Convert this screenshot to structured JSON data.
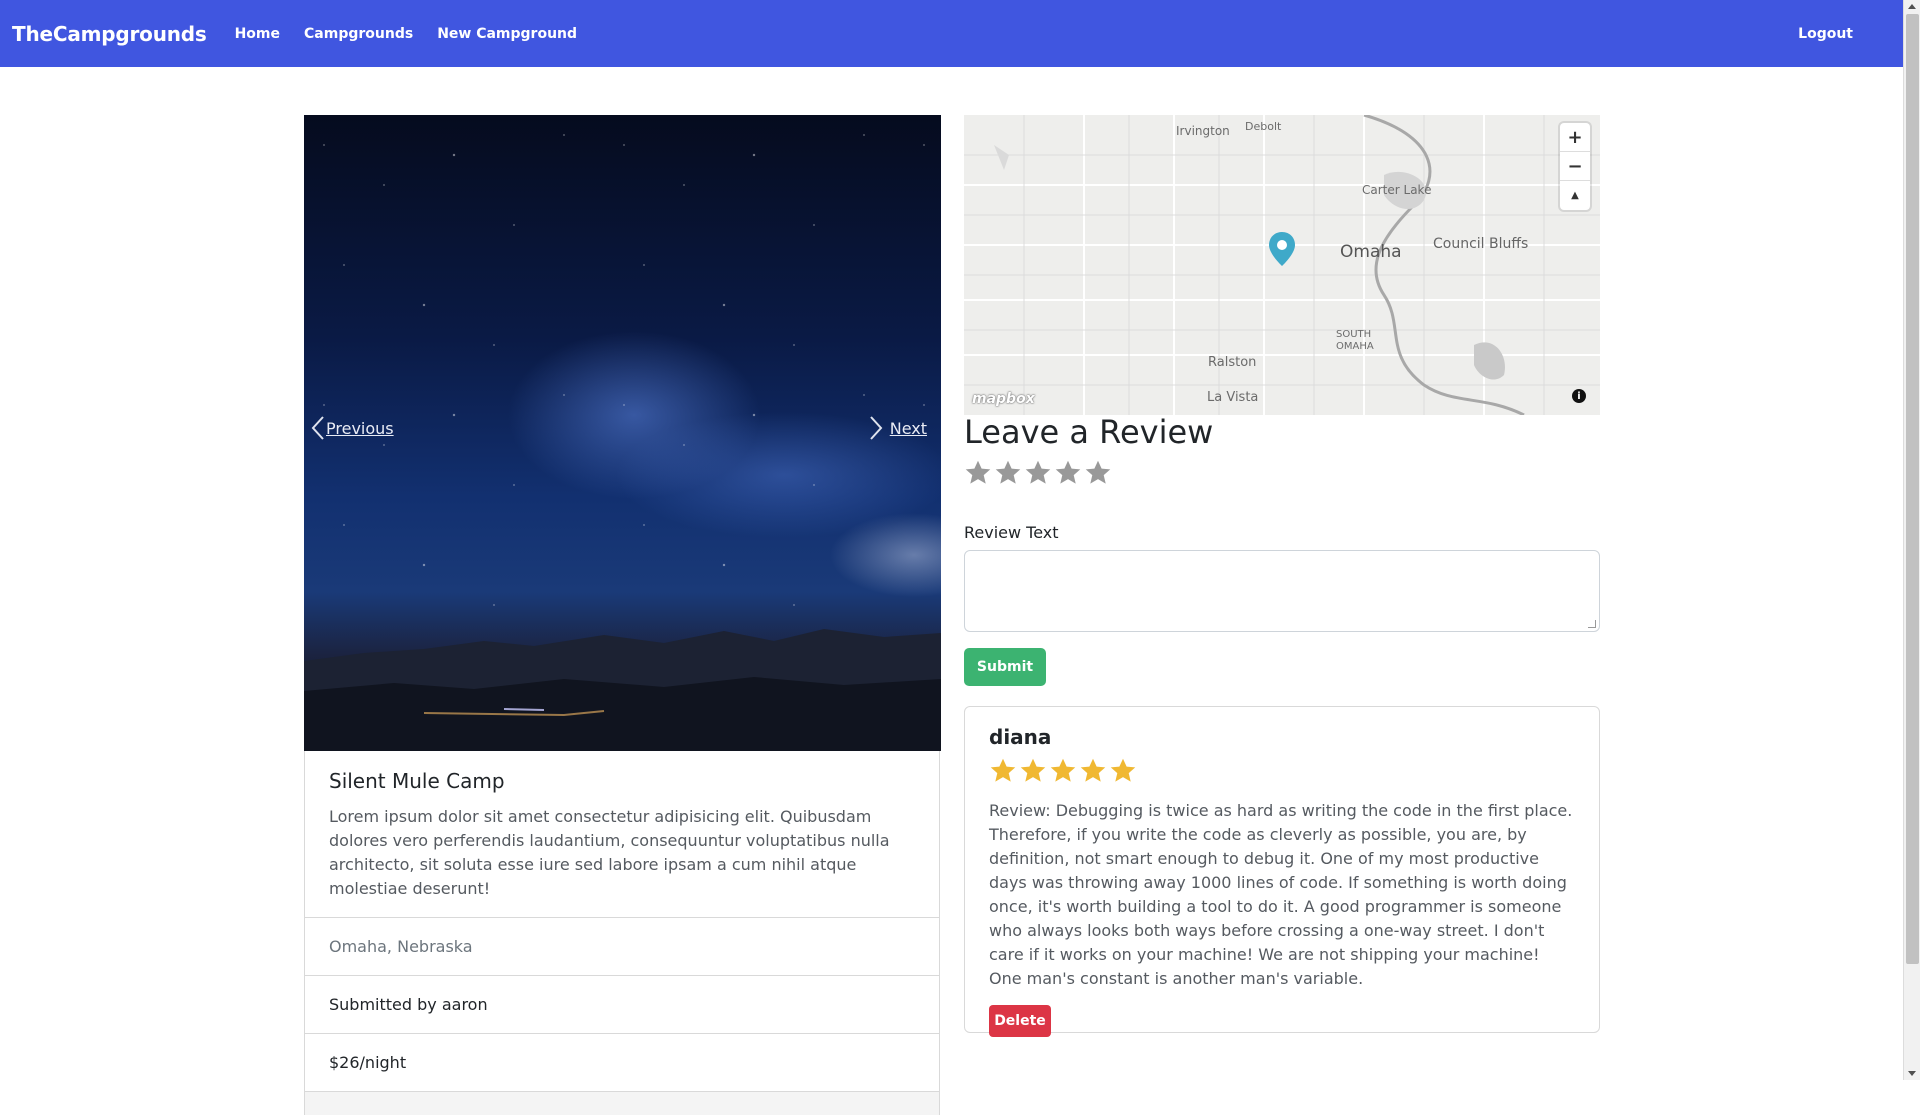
{
  "navbar": {
    "brand": "TheCampgrounds",
    "links": [
      "Home",
      "Campgrounds",
      "New Campground"
    ],
    "logout": "Logout",
    "color": "#4056e0"
  },
  "carousel": {
    "prev_label": "Previous",
    "next_label": "Next"
  },
  "campground": {
    "title": "Silent Mule Camp",
    "description": "Lorem ipsum dolor sit amet consectetur adipisicing elit. Quibusdam dolores vero perferendis laudantium, consequuntur voluptatibus nulla architecto, sit soluta esse iure sed labore ipsam a cum nihil atque molestiae deserunt!",
    "location": "Omaha, Nebraska",
    "submitted_by": "Submitted by aaron",
    "price": "$26/night"
  },
  "map": {
    "labels": {
      "irvington": "Irvington",
      "debolt": "Debolt",
      "carter_lake": "Carter Lake",
      "omaha": "Omaha",
      "council_bluffs": "Council Bluffs",
      "south_omaha": "SOUTH OMAHA",
      "ralston": "Ralston",
      "la_vista": "La Vista"
    },
    "attribution": "mapbox",
    "zoom_in": "+",
    "zoom_out": "−",
    "compass": "▲",
    "marker_color": "#3fa9c9"
  },
  "review_form": {
    "title": "Leave a Review",
    "rating": 0,
    "max_rating": 5,
    "text_label": "Review Text",
    "text_value": "",
    "submit_label": "Submit",
    "submit_color": "#3cb371"
  },
  "reviews": [
    {
      "author": "diana",
      "rating": 5,
      "text": "Review: Debugging is twice as hard as writing the code in the first place. Therefore, if you write the code as cleverly as possible, you are, by definition, not smart enough to debug it. One of my most productive days was throwing away 1000 lines of code. If something is worth doing once, it's worth building a tool to do it. A good programmer is someone who always looks both ways before crossing a one-way street. I don't care if it works on your machine! We are not shipping your machine! One man's constant is another man's variable.",
      "delete_label": "Delete"
    }
  ],
  "colors": {
    "star_filled": "#f0b832",
    "star_empty": "#999999",
    "delete": "#dc3545"
  }
}
